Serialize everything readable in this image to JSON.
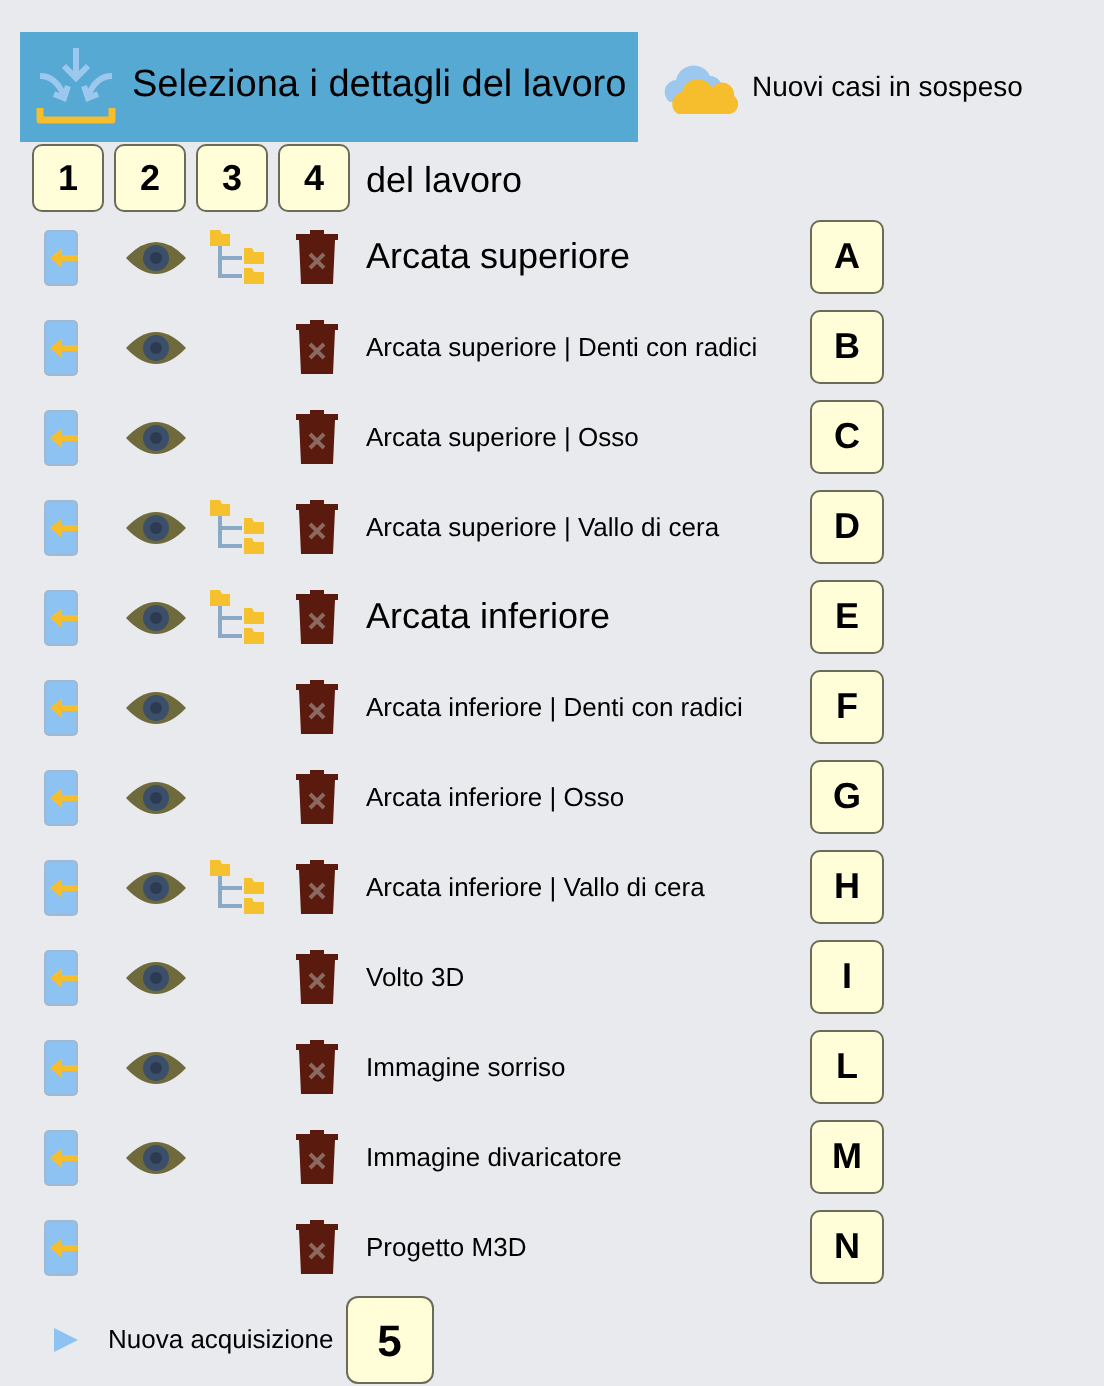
{
  "header": {
    "title": "Seleziona i dettagli del lavoro",
    "selected": true
  },
  "pending_link": "Nuovi casi in sospeso",
  "section_heading": "del lavoro",
  "callouts": [
    "1",
    "2",
    "3",
    "4"
  ],
  "rows": [
    {
      "label": "Arcata superiore",
      "kind": "group",
      "eye": true,
      "tree": true,
      "badge": "A"
    },
    {
      "label": "Arcata superiore | Denti con radici",
      "kind": "item",
      "eye": true,
      "tree": false,
      "badge": "B"
    },
    {
      "label": "Arcata superiore | Osso",
      "kind": "item",
      "eye": true,
      "tree": false,
      "badge": "C"
    },
    {
      "label": "Arcata superiore | Vallo di cera",
      "kind": "item",
      "eye": true,
      "tree": true,
      "badge": "D"
    },
    {
      "label": "Arcata inferiore",
      "kind": "group",
      "eye": true,
      "tree": true,
      "badge": "E"
    },
    {
      "label": "Arcata inferiore | Denti con radici",
      "kind": "item",
      "eye": true,
      "tree": false,
      "badge": "F"
    },
    {
      "label": "Arcata inferiore | Osso",
      "kind": "item",
      "eye": true,
      "tree": false,
      "badge": "G"
    },
    {
      "label": "Arcata inferiore | Vallo di cera",
      "kind": "item",
      "eye": true,
      "tree": true,
      "badge": "H"
    },
    {
      "label": "Volto 3D",
      "kind": "item",
      "eye": true,
      "tree": false,
      "badge": "I"
    },
    {
      "label": "Immagine sorriso",
      "kind": "item",
      "eye": true,
      "tree": false,
      "badge": "L"
    },
    {
      "label": "Immagine divaricatore",
      "kind": "item",
      "eye": true,
      "tree": false,
      "badge": "M"
    },
    {
      "label": "Progetto M3D",
      "kind": "item",
      "eye": false,
      "tree": false,
      "badge": "N"
    }
  ],
  "new_acquisition": "Nuova acquisizione",
  "callout_5": "5"
}
